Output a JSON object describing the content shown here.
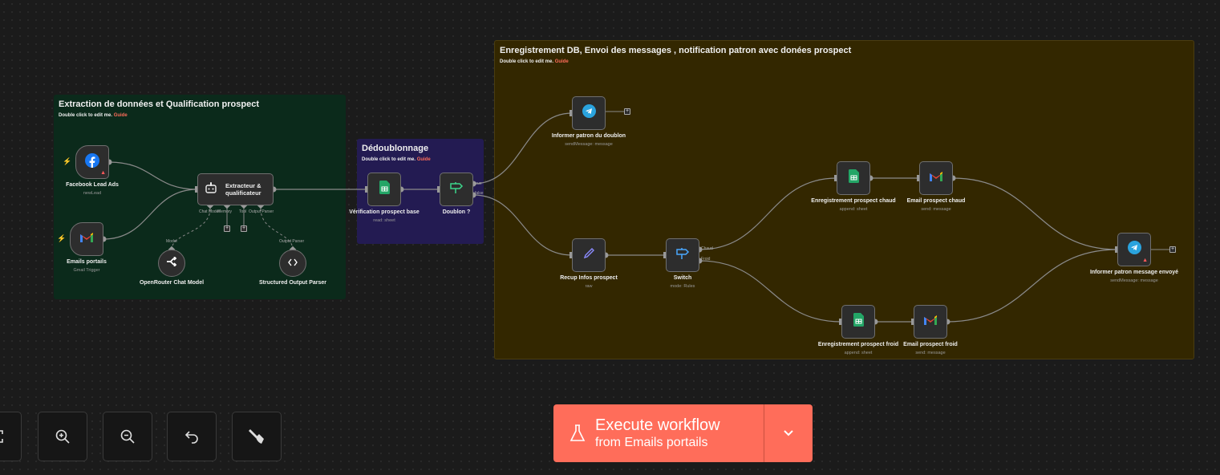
{
  "groups": [
    {
      "id": "g1",
      "title": "Extraction de données et Qualification prospect",
      "hint": "Double click to edit me.",
      "guide": "Guide",
      "color": "#0b2a1b"
    },
    {
      "id": "g2",
      "title": "Dédoublonnage",
      "hint": "Double click to edit me.",
      "guide": "Guide",
      "color": "#231b52"
    },
    {
      "id": "g3",
      "title": "Enregistrement DB, Envoi des messages , notification patron avec donées prospect",
      "hint": "Double click to edit me.",
      "guide": "Guide",
      "color": "#332700"
    }
  ],
  "nodes": [
    {
      "id": "fb",
      "label": "Facebook Lead Ads",
      "sub": "newLead",
      "icon": "facebook-icon",
      "warning": true,
      "trigger": true
    },
    {
      "id": "gmt",
      "label": "Emails portails",
      "sub": "Gmail Trigger",
      "icon": "gmail-icon",
      "trigger": true
    },
    {
      "id": "agent",
      "label": "Extracteur & qualificateur",
      "sub": "",
      "icon": "robot-icon"
    },
    {
      "id": "or",
      "label": "OpenRouter Chat Model",
      "sub": "",
      "icon": "openrouter-icon"
    },
    {
      "id": "sop",
      "label": "Structured Output Parser",
      "sub": "",
      "icon": "code-brackets-icon"
    },
    {
      "id": "ver",
      "label": "Vérification prospect base",
      "sub": "read: sheet",
      "icon": "google-sheets-icon"
    },
    {
      "id": "dbl",
      "label": "Doublon ?",
      "sub": "",
      "icon": "signpost-icon-green"
    },
    {
      "id": "tg1",
      "label": "Informer patron du doublon",
      "sub": "sendMessage: message",
      "icon": "telegram-icon"
    },
    {
      "id": "rec",
      "label": "Recup Infos prospect",
      "sub": "raw",
      "icon": "pencil-icon"
    },
    {
      "id": "sw",
      "label": "Switch",
      "sub": "mode: Rules",
      "icon": "signpost-icon-blue"
    },
    {
      "id": "ec",
      "label": "Enregistrement prospect chaud",
      "sub": "append: sheet",
      "icon": "google-sheets-icon"
    },
    {
      "id": "mc",
      "label": "Email prospect chaud",
      "sub": "send: message",
      "icon": "gmail-icon"
    },
    {
      "id": "ef",
      "label": "Enregistrement prospect froid",
      "sub": "append: sheet",
      "icon": "google-sheets-icon"
    },
    {
      "id": "mf",
      "label": "Email prospect froid",
      "sub": "send: message",
      "icon": "gmail-icon"
    },
    {
      "id": "tg2",
      "label": "Informer patron message envoyé",
      "sub": "sendMessage: message",
      "icon": "telegram-icon",
      "warning": true
    }
  ],
  "ports": {
    "chat_model": "Chat Model",
    "memory": "Memory",
    "tool": "Tool",
    "output_parser": "Output Parser",
    "model": "Model",
    "output_parser_in": "Output Parser",
    "true": "true",
    "false": "false",
    "chaud": "Chaud",
    "froid": "Froid"
  },
  "controls": [
    {
      "name": "fit-view",
      "icon": "fit-icon"
    },
    {
      "name": "zoom-in",
      "icon": "zoom-in-icon"
    },
    {
      "name": "zoom-out",
      "icon": "zoom-out-icon"
    },
    {
      "name": "undo",
      "icon": "undo-icon"
    },
    {
      "name": "tidy-up",
      "icon": "broom-icon"
    }
  ],
  "execute": {
    "title": "Execute workflow",
    "subtitle": "from Emails portails",
    "accent": "#ff6d5a"
  }
}
